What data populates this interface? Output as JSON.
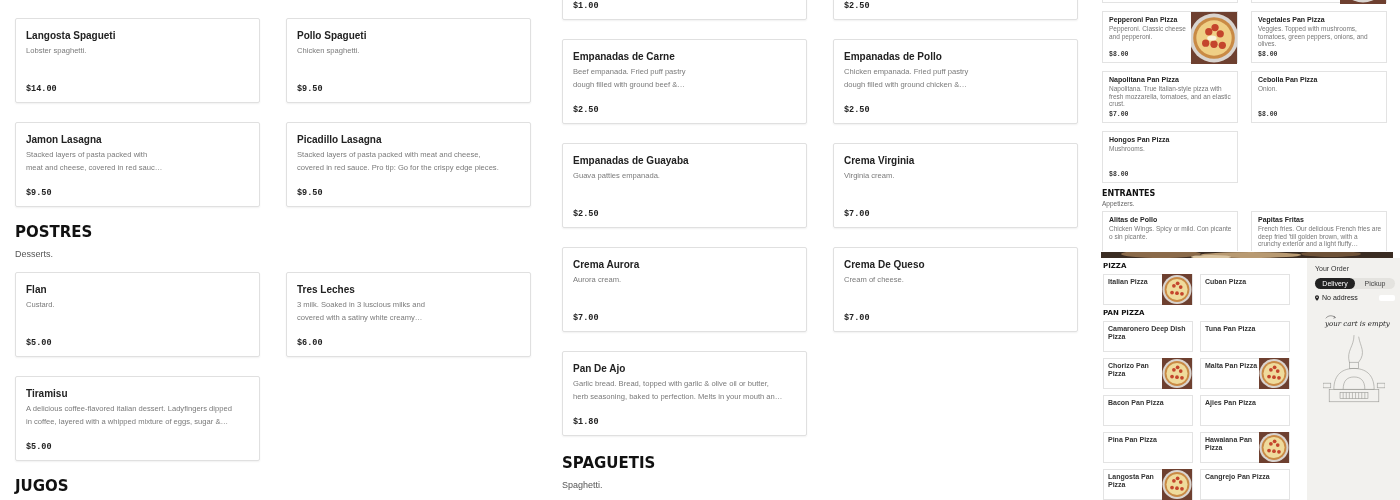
{
  "pasta_desserts_page": {
    "blocks": [
      {
        "kind": "cards",
        "items": [
          {
            "name": "Langosta Spagueti",
            "description": "Lobster spaghetti.",
            "price": "$14.00"
          },
          {
            "name": "Pollo Spagueti",
            "description": "Chicken spaghetti.",
            "price": "$9.50"
          },
          {
            "name": "Jamon Lasagna",
            "description": "Stacked layers of pasta packed with\nmeat and cheese, covered in red sauc…",
            "price": "$9.50"
          },
          {
            "name": "Picadillo Lasagna",
            "description": "Stacked layers of pasta packed with meat and cheese,\ncovered in red sauce. Pro tip: Go for the crispy edge pieces.",
            "price": "$9.50"
          }
        ]
      },
      {
        "kind": "heading",
        "title": "POSTRES",
        "subtitle": "Desserts."
      },
      {
        "kind": "cards",
        "items": [
          {
            "name": "Flan",
            "description": "Custard.",
            "price": "$5.00"
          },
          {
            "name": "Tres Leches",
            "description": "3 milk. Soaked in 3 luscious milks and\ncovered with a satiny white creamy…",
            "price": "$6.00"
          },
          {
            "name": "Tiramisu",
            "description": "A delicious coffee-flavored italian dessert. Ladyfingers dipped\nin coffee, layered with a whipped mixture of eggs, sugar &…",
            "price": "$5.00"
          }
        ]
      },
      {
        "kind": "heading",
        "title": "JUGOS"
      }
    ]
  },
  "appetizers_page": {
    "blocks": [
      {
        "kind": "cards",
        "items": [
          {
            "price": "$1.00"
          },
          {
            "price": "$2.50"
          },
          {
            "name": "Empanadas de Carne",
            "description": "Beef empanada. Fried puff pastry\ndough filled with ground beef &…",
            "price": "$2.50"
          },
          {
            "name": "Empanadas de Pollo",
            "description": "Chicken empanada. Fried puff pastry\ndough filled with ground chicken &…",
            "price": "$2.50"
          },
          {
            "name": "Empanadas de Guayaba",
            "description": "Guava patties empanada.",
            "price": "$2.50"
          },
          {
            "name": "Crema Virginia",
            "description": "Virginia cream.",
            "price": "$7.00"
          },
          {
            "name": "Crema Aurora",
            "description": "Aurora cream.",
            "price": "$7.00"
          },
          {
            "name": "Crema De Queso",
            "description": "Cream of cheese.",
            "price": "$7.00"
          },
          {
            "name": "Pan De Ajo",
            "description": "Garlic bread. Bread, topped with garlic & olive oil or butter,\nherb seasoning, baked to perfection. Melts in your mouth an…",
            "price": "$1.80"
          }
        ]
      },
      {
        "kind": "heading",
        "title": "SPAGUETIS",
        "subtitle": "Spaghetti."
      }
    ]
  },
  "pan_pizza_page": {
    "blocks": [
      {
        "kind": "cards",
        "items": [
          {
            "has_photo": false
          },
          {
            "has_photo": true
          },
          {
            "name": "Pepperoni Pan Pizza",
            "description": "Pepperoni. Classic cheese and\npepperoni.",
            "price": "$8.00",
            "has_photo": true
          },
          {
            "name": "Vegetales Pan Pizza",
            "description": "Veggies. Topped with mushrooms, tomatoes, green peppers,\nonions, and olives.",
            "price": "$8.00",
            "has_photo": false
          },
          {
            "name": "Napolitana Pan Pizza",
            "description": "Napolitana. True Italian-style pizza with fresh mozzarella,\ntomatoes, and an elastic crust.",
            "price": "$7.00",
            "has_photo": false
          },
          {
            "name": "Cebolla Pan Pizza",
            "description": "Onion.",
            "price": "$8.00",
            "has_photo": false
          },
          {
            "name": "Hongos Pan Pizza",
            "description": "Mushrooms.",
            "price": "$8.00",
            "has_photo": false
          }
        ]
      },
      {
        "kind": "heading",
        "title": "ENTRANTES",
        "subtitle": "Appetizers."
      },
      {
        "kind": "cards",
        "items": [
          {
            "name": "Alitas de Pollo",
            "description": "Chicken Wings. Spicy or mild. Con picante o sin picante.",
            "has_photo": false
          },
          {
            "name": "Papitas Fritas",
            "description": "French fries. Our delicious French fries are deep fried 'till\ngolden brown, with a crunchy exterior and a light fluffy…",
            "has_photo": false
          }
        ]
      }
    ]
  },
  "pizza_order_page": {
    "sections": [
      {
        "title": "PIZZA",
        "items": [
          {
            "name": "Italian Pizza",
            "has_photo": true
          },
          {
            "name": "Cuban Pizza",
            "has_photo": false
          }
        ]
      },
      {
        "title": "PAN PIZZA",
        "items": [
          {
            "name": "Camaronero Deep Dish Pizza",
            "has_photo": false
          },
          {
            "name": "Tuna Pan Pizza",
            "has_photo": false
          },
          {
            "name": "Chorizo Pan Pizza",
            "has_photo": true
          },
          {
            "name": "Malta Pan Pizza",
            "has_photo": true
          },
          {
            "name": "Bacon Pan Pizza",
            "has_photo": false
          },
          {
            "name": "Ajies Pan Pizza",
            "has_photo": false
          },
          {
            "name": "Pina Pan Pizza",
            "has_photo": false
          },
          {
            "name": "Hawaiana Pan Pizza",
            "has_photo": true
          },
          {
            "name": "Langosta Pan Pizza",
            "has_photo": true
          },
          {
            "name": "Cangrejo Pan Pizza",
            "has_photo": false
          }
        ]
      }
    ],
    "order": {
      "title": "Your Order",
      "tabs": [
        {
          "label": "Delivery",
          "selected": true
        },
        {
          "label": "Pickup",
          "selected": false
        }
      ],
      "address": "No address",
      "empty_text": "your cart is empty"
    }
  }
}
